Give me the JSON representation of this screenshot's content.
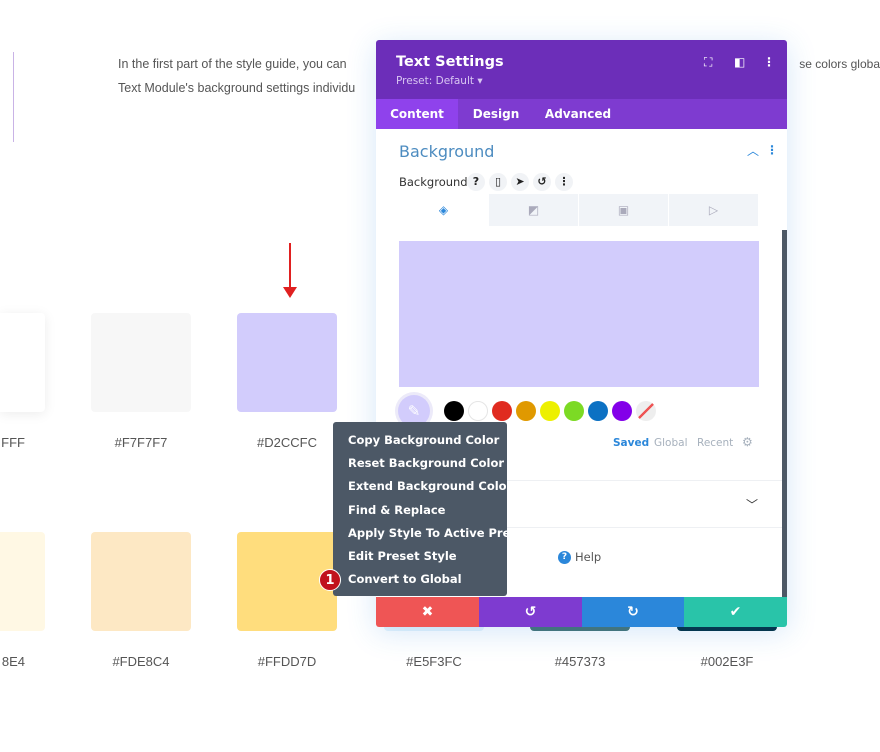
{
  "page": {
    "intro_line1": "In the first part of the style guide, you can",
    "intro_line1_end": "se colors globa",
    "intro_line2": "Text Module's background settings individu"
  },
  "swatches": {
    "row1": [
      {
        "color": "#FFFFFF",
        "label": "FFF"
      },
      {
        "color": "#F7F7F7",
        "label": "#F7F7F7"
      },
      {
        "color": "#D2CCFC",
        "label": "#D2CCFC"
      }
    ],
    "row2": [
      {
        "color": "#FFF8E4",
        "label": "8E4"
      },
      {
        "color": "#FDE8C4",
        "label": "#FDE8C4"
      },
      {
        "color": "#FFDD7D",
        "label": "#FFDD7D"
      },
      {
        "color": "#E5F3FC",
        "label": "#E5F3FC"
      },
      {
        "color": "#457373",
        "label": "#457373"
      },
      {
        "color": "#002E3F",
        "label": "#002E3F"
      }
    ]
  },
  "panel": {
    "title": "Text Settings",
    "preset": "Preset: Default ▾",
    "tabs": [
      "Content",
      "Design",
      "Advanced"
    ],
    "active_tab": "Content",
    "section": "Background",
    "field_label": "Background",
    "preview_color": "#D2CCFC",
    "palette": [
      "#000000",
      "#FFFFFF",
      "#E02B20",
      "#E09900",
      "#EDF000",
      "#7CDA24",
      "#0C71C3",
      "#8300E9"
    ],
    "palette_tabs": [
      "Saved",
      "Global",
      "Recent"
    ],
    "help": "Help",
    "icons": [
      "fullscreen-icon",
      "split-view-icon",
      "more-icon"
    ]
  },
  "context_menu": {
    "items": [
      "Copy Background Color",
      "Reset Background Color",
      "Extend Background Color",
      "Find & Replace",
      "Apply Style To Active Preset",
      "Edit Preset Style",
      "Convert to Global"
    ],
    "badge": "1"
  },
  "footer": {
    "cancel": "✖",
    "undo": "↺",
    "redo": "↻",
    "save": "✔"
  }
}
